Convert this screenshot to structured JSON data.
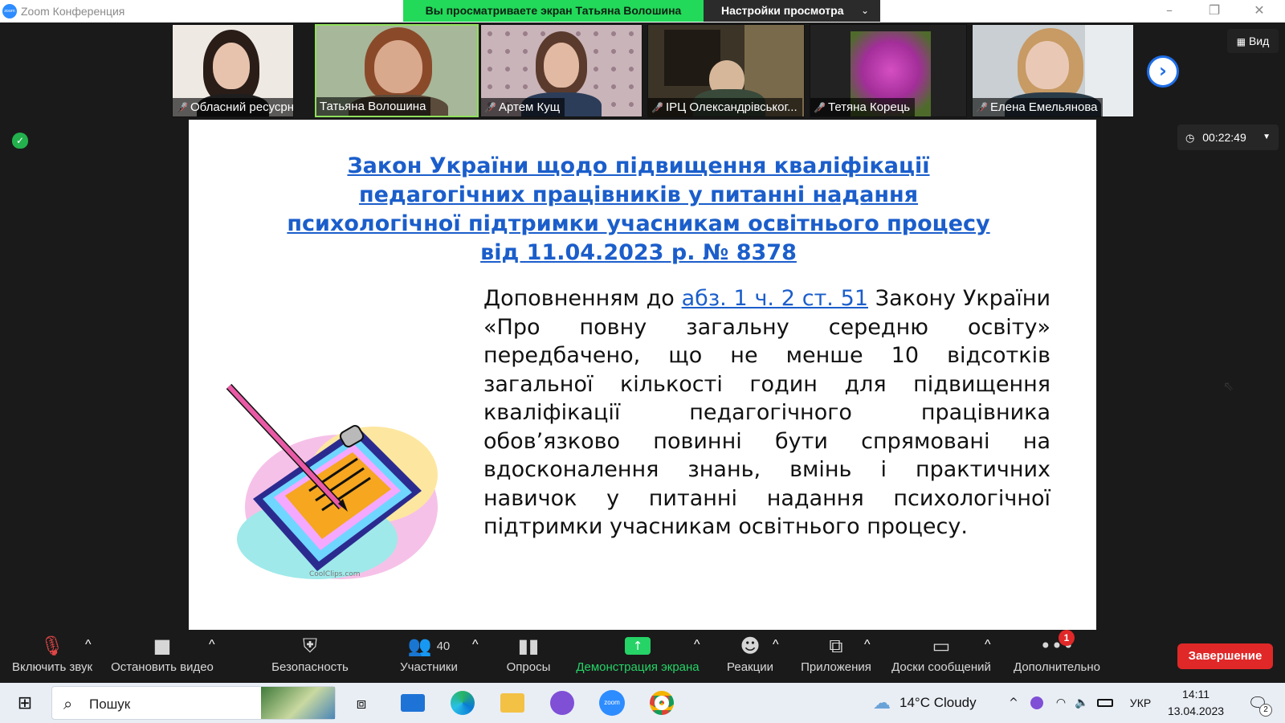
{
  "window": {
    "app_icon": "zoom",
    "title": "Zoom Конференция",
    "share_banner": "Вы просматриваете экран Татьяна Волошина",
    "view_settings": "Настройки просмотра"
  },
  "participants": [
    {
      "name": "Обласний ресусрний ...",
      "muted": true
    },
    {
      "name": "Татьяна Волошина",
      "muted": false,
      "speaking": true
    },
    {
      "name": "Артем Кущ",
      "muted": true
    },
    {
      "name": "ІРЦ Олександрівськог...",
      "muted": true
    },
    {
      "name": "Тетяна Корець",
      "muted": true
    },
    {
      "name": "Елена Емельянова",
      "muted": true
    }
  ],
  "view_button": "Вид",
  "timer": "00:22:49",
  "slide": {
    "title": "Закон України щодо підвищення кваліфікації педагогічних працівників у питанні надання психологічної підтримки учасникам освітнього процесу від 11.04.2023 р. № 8378",
    "body_prefix": "Доповненням до",
    "body_link": "абз. 1 ч. 2 ст. 51",
    "body_rest": "Закону України «Про повну загальну середню освіту» передбачено, що не менше 10 відсотків загальної кількості годин для підвищення кваліфікації педагогічного працівника обов’язково повинні бути спрямовані на вдосконалення знань, вмінь і практичних навичок у питанні надання психологічної підтримки учасникам освітнього процесу.",
    "clipart_credit": "CoolClips.com"
  },
  "toolbar": {
    "mute": "Включить звук",
    "video": "Остановить видео",
    "security": "Безопасность",
    "participants": "Участники",
    "participants_count": "40",
    "polls": "Опросы",
    "share": "Демонстрация экрана",
    "reactions": "Реакции",
    "apps": "Приложения",
    "whiteboards": "Доски сообщений",
    "more": "Дополнительно",
    "more_badge": "1",
    "end": "Завершение"
  },
  "taskbar": {
    "search": "Пошук",
    "weather": "14°C  Cloudy",
    "lang": "УКР",
    "time": "14:11",
    "date": "13.04.2023",
    "notifications": "2"
  },
  "colors": {
    "share_green": "#23d959",
    "link_blue": "#1b5ecb",
    "end_red": "#e02828",
    "muted_red": "#ff4b4b"
  }
}
